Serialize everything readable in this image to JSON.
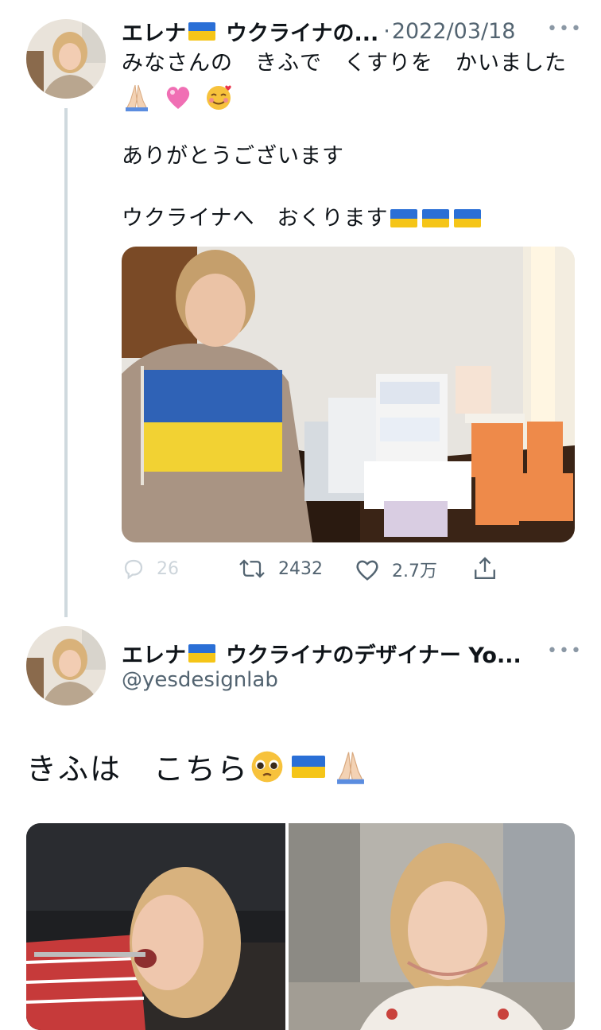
{
  "tweet1": {
    "display_name": "エレナ",
    "name_suffix": "ウクライナの...",
    "date_sep": "·",
    "date": "2022/03/18",
    "more": "•••",
    "line1": "みなさんの　きふで　くすりを　かいました",
    "line2": "ありがとうございます",
    "line3": "ウクライナへ　おくります",
    "actions": {
      "replies": "26",
      "retweets": "2432",
      "likes": "2.7万"
    }
  },
  "tweet2": {
    "display_name": "エレナ",
    "name_suffix": "ウクライナのデザイナー Yo...",
    "handle": "@yesdesignlab",
    "more": "•••",
    "text": "きふは　こちら"
  },
  "icons": {
    "flag": "ukraine-flag-icon",
    "praying": "praying-hands-icon",
    "heart": "pink-heart-icon",
    "smile": "smiling-face-with-hearts-icon",
    "pleading": "pleading-face-icon",
    "reply": "reply-icon",
    "retweet": "retweet-icon",
    "like": "like-icon",
    "share": "share-icon"
  },
  "colors": {
    "text": "#0f1419",
    "secondary": "#536471",
    "thread_line": "#cfd9de",
    "flag_blue": "#2a6fd6",
    "flag_yellow": "#f5c518"
  }
}
